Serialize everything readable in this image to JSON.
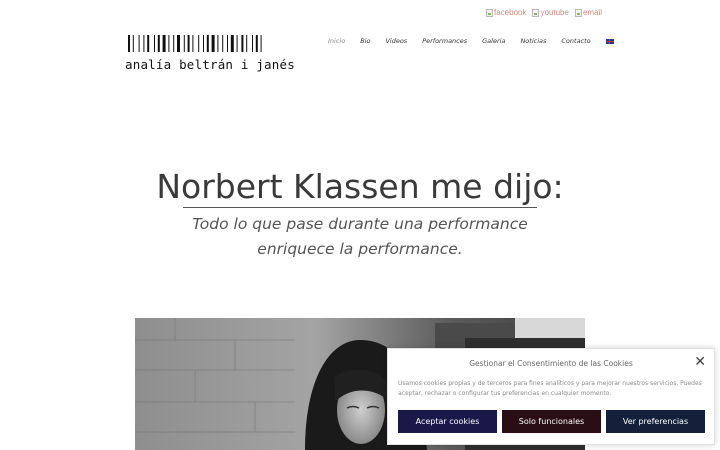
{
  "social": [
    {
      "label": "facebook",
      "icon": "broken-image-icon"
    },
    {
      "label": "youtube",
      "icon": "broken-image-icon"
    },
    {
      "label": "email",
      "icon": "broken-image-icon"
    }
  ],
  "logo": {
    "text": "analía beltrán i janés"
  },
  "nav": {
    "items": [
      {
        "label": "Inicio"
      },
      {
        "label": "Bio"
      },
      {
        "label": "Videos"
      },
      {
        "label": "Performances"
      },
      {
        "label": "Galeria"
      },
      {
        "label": "Noticias"
      },
      {
        "label": "Contacto"
      }
    ],
    "active_index": 0,
    "language_icon": "uk-flag-icon"
  },
  "main": {
    "title": "Norbert Klassen me dijo:",
    "quote": "Todo lo que pase durante una performance enriquece la performance."
  },
  "cookie": {
    "title": "Gestionar el Consentimiento de las Cookies",
    "text": "Usamos cookies propias y de terceros para fines analíticos y para mejorar nuestros servicios. Puedes aceptar, rechazar o configurar tus preferencias en cualquier momento.",
    "accept_label": "Aceptar cookies",
    "functional_label": "Solo funcionales",
    "prefs_label": "Ver preferencias",
    "close_icon": "close-icon"
  },
  "colors": {
    "social_link": "#d08a7e",
    "accept_bg": "#1a1848",
    "functional_bg": "#2a0e16",
    "prefs_bg": "#14203a"
  }
}
